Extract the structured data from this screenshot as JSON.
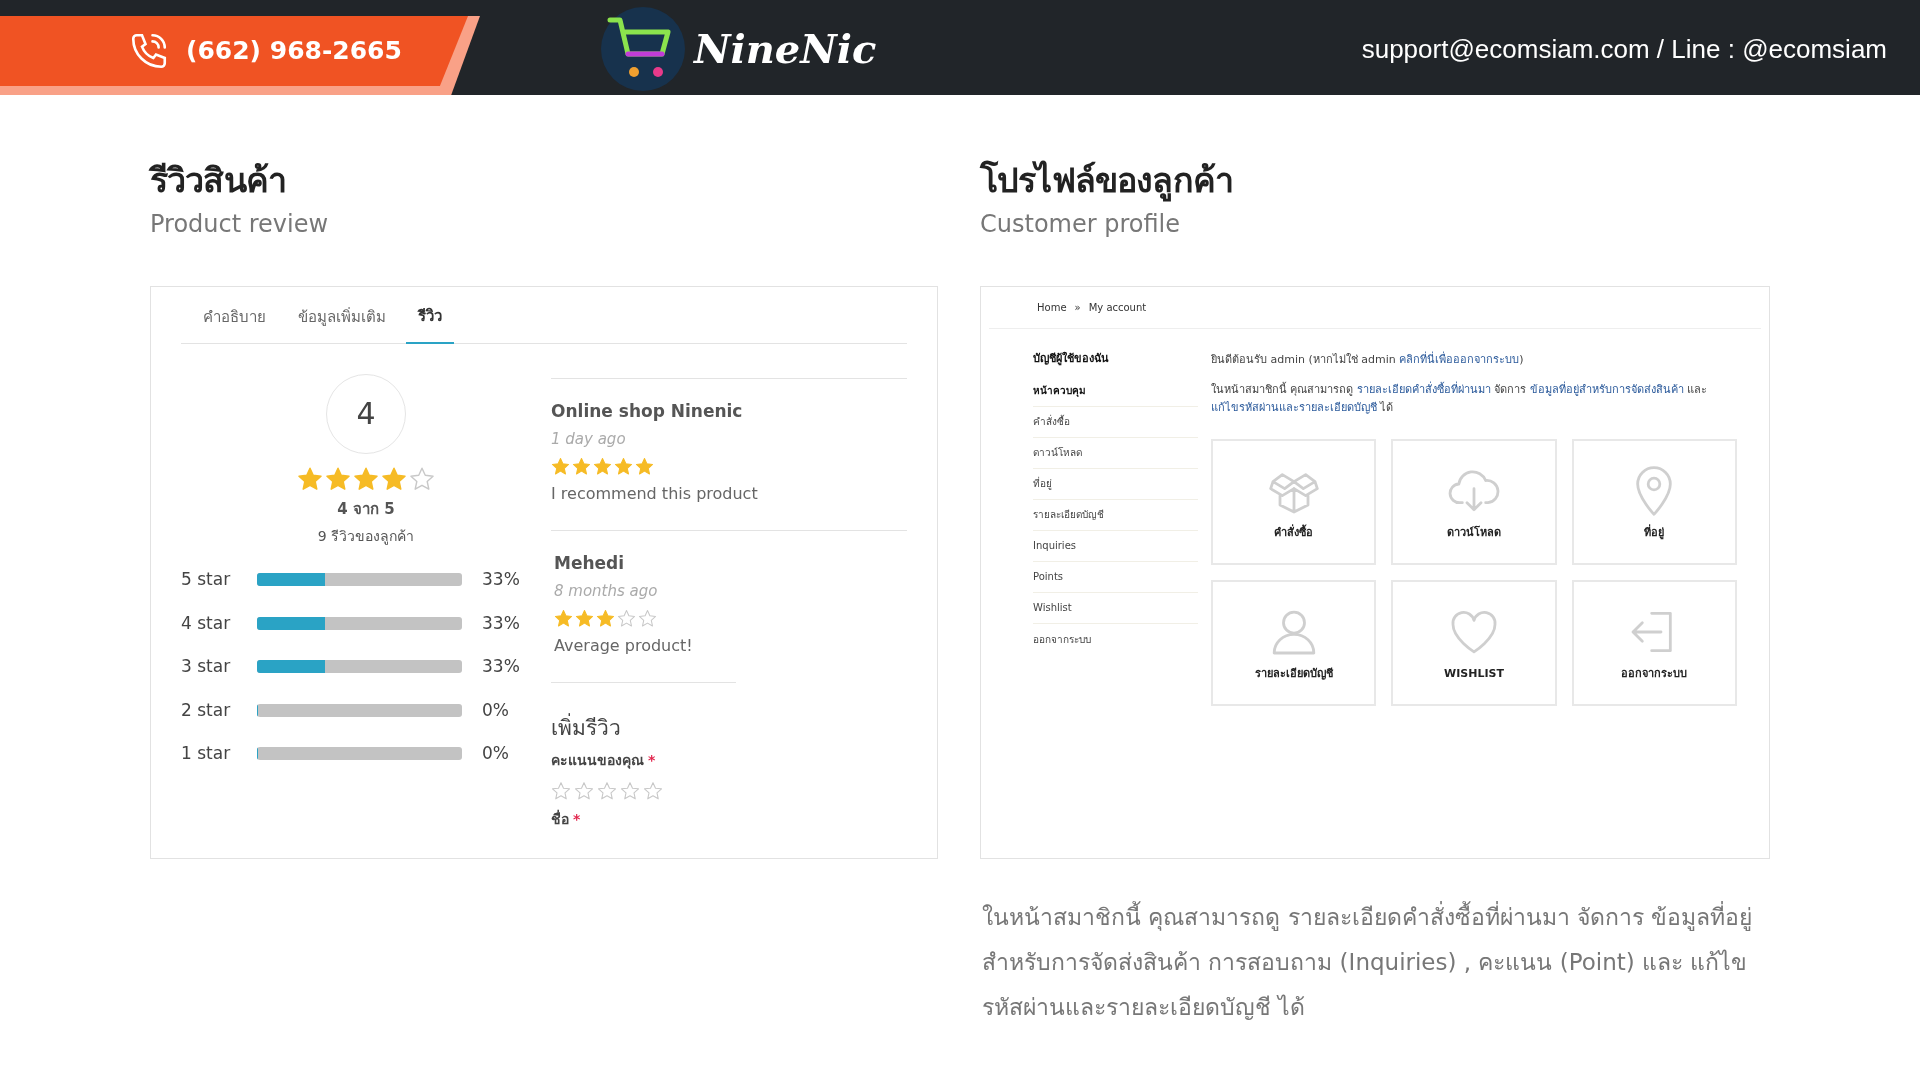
{
  "header": {
    "phone": "(662) 968-2665",
    "logo_text": "NineNic",
    "contact": "support@ecomsiam.com / Line : @ecomsiam"
  },
  "review_section": {
    "title": "รีวิวสินค้า",
    "subtitle": "Product review",
    "tabs": [
      {
        "label": "คำอธิบาย",
        "selected": false
      },
      {
        "label": "ข้อมูลเพิ่มเติม",
        "selected": false
      },
      {
        "label": "รีวิว",
        "selected": true
      }
    ],
    "average": "4",
    "stars": 4,
    "score_text": "4 จาก 5",
    "count_text": "9 รีวิวของลูกค้า",
    "breakdown": [
      {
        "label": "5 star",
        "level": 0.33,
        "reading": "33%"
      },
      {
        "label": "4 star",
        "level": 0.33,
        "reading": "33%"
      },
      {
        "label": "3 star",
        "level": 0.33,
        "reading": "33%"
      },
      {
        "label": "2 star",
        "level": 0,
        "reading": "0%"
      },
      {
        "label": "1 star",
        "level": 0,
        "reading": "0%"
      }
    ],
    "reviews": [
      {
        "author": "Online shop Ninenic",
        "time": "1 day ago",
        "stars": 5,
        "text": "I recommend this product"
      },
      {
        "author": "Mehedi",
        "time": "8 months ago",
        "stars": 3,
        "text": "Average product!"
      }
    ],
    "form": {
      "title": "เพิ่มรีวิว",
      "rating_label": "คะแนนของคุณ",
      "required_mark": "*",
      "stars": 0,
      "name_label": "ชื่อ",
      "name_required_mark": "*"
    }
  },
  "profile_section": {
    "title": "โปรไฟล์ของลูกค้า",
    "subtitle": "Customer profile",
    "breadcrumb": [
      "Home",
      "»",
      "My account"
    ],
    "sidebar": {
      "title": "บัญชีผู้ใช้ของฉัน",
      "items": [
        {
          "label": "หน้าควบคุม",
          "selected": true
        },
        {
          "label": "คำสั่งซื้อ",
          "selected": false
        },
        {
          "label": "ดาวน์โหลด",
          "selected": false
        },
        {
          "label": "ที่อยู่",
          "selected": false
        },
        {
          "label": "รายละเอียดบัญชี",
          "selected": false
        },
        {
          "label": "Inquiries",
          "selected": false
        },
        {
          "label": "Points",
          "selected": false
        },
        {
          "label": "Wishlist",
          "selected": false
        },
        {
          "label": "ออกจากระบบ",
          "selected": false
        }
      ]
    },
    "welcome": [
      {
        "kind": "text",
        "text": "ยินดีต้อนรับ admin (หากไม่ใช่ admin "
      },
      {
        "kind": "link",
        "text": "คลิกที่นี่เพื่อออกจากระบบ"
      },
      {
        "kind": "text",
        "text": ")"
      }
    ],
    "intro": [
      {
        "kind": "text",
        "text": "ในหน้าสมาชิกนี้ คุณสามารถดู "
      },
      {
        "kind": "link",
        "text": "รายละเอียดคำสั่งซื้อที่ผ่านมา"
      },
      {
        "kind": "text",
        "text": " จัดการ "
      },
      {
        "kind": "link",
        "text": "ข้อมูลที่อยู่สำหรับการจัดส่งสินค้า"
      },
      {
        "kind": "text",
        "text": " และ "
      },
      {
        "kind": "link",
        "text": "แก้ไขรหัสผ่านและ"
      },
      {
        "kind": "link",
        "text": "รายละเอียดบัญชี"
      },
      {
        "kind": "text",
        "text": " ได้"
      }
    ],
    "tiles": [
      {
        "kind": "box",
        "label": "คำสั่งซื้อ"
      },
      {
        "kind": "download",
        "label": "ดาวน์โหลด"
      },
      {
        "kind": "pin",
        "label": "ที่อยู่"
      },
      {
        "kind": "user",
        "label": "รายละเอียดบัญชี"
      },
      {
        "kind": "heart",
        "label": "WISHLIST"
      },
      {
        "kind": "logout",
        "label": "ออกจากระบบ"
      }
    ],
    "description": "ในหน้าสมาชิกนี้ คุณสามารถดู รายละเอียดคำสั่งซื้อที่ผ่านมา จัดการ ข้อมูลที่อยู่สำหรับการจัดส่งสินค้า การสอบถาม (Inquiries) , คะแนน (Point) และ แก้ไขรหัสผ่านและรายละเอียดบัญชี ได้"
  }
}
